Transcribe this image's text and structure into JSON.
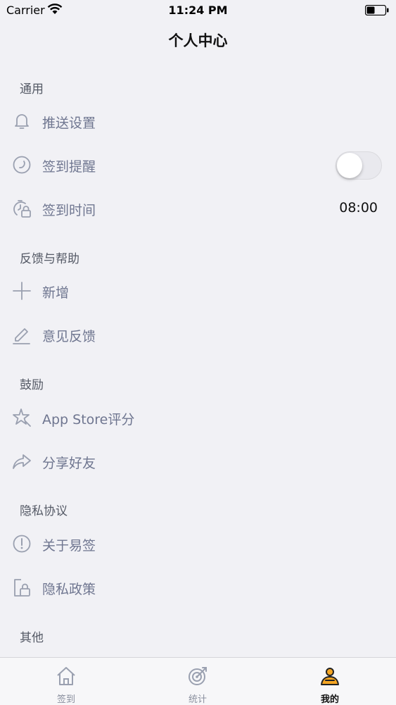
{
  "status_bar": {
    "carrier": "Carrier",
    "time": "11:24 PM"
  },
  "nav": {
    "title": "个人中心"
  },
  "sections": [
    {
      "header": "通用",
      "items": [
        {
          "label": "推送设置",
          "icon": "bell-icon"
        },
        {
          "label": "签到提醒",
          "icon": "clock-icon",
          "toggle_on": false
        },
        {
          "label": "签到时间",
          "icon": "timer-lock-icon",
          "value": "08:00"
        }
      ]
    },
    {
      "header": "反馈与帮助",
      "items": [
        {
          "label": "新增",
          "icon": "plus-icon"
        },
        {
          "label": "意见反馈",
          "icon": "edit-icon"
        }
      ]
    },
    {
      "header": "鼓励",
      "items": [
        {
          "label": "App Store评分",
          "icon": "star-icon"
        },
        {
          "label": "分享好友",
          "icon": "share-icon"
        }
      ]
    },
    {
      "header": "隐私协议",
      "items": [
        {
          "label": "关于易签",
          "icon": "info-icon"
        },
        {
          "label": "隐私政策",
          "icon": "privacy-lock-icon"
        }
      ]
    },
    {
      "header": "其他",
      "items": []
    }
  ],
  "tab_bar": {
    "tabs": [
      {
        "label": "签到",
        "icon": "home-icon",
        "active": false
      },
      {
        "label": "统计",
        "icon": "target-icon",
        "active": false
      },
      {
        "label": "我的",
        "icon": "profile-icon",
        "active": true
      }
    ]
  },
  "colors": {
    "background": "#f1f1f5",
    "item_text": "#6f7690",
    "icon": "#9aa0b0",
    "accent": "#f5a623"
  }
}
